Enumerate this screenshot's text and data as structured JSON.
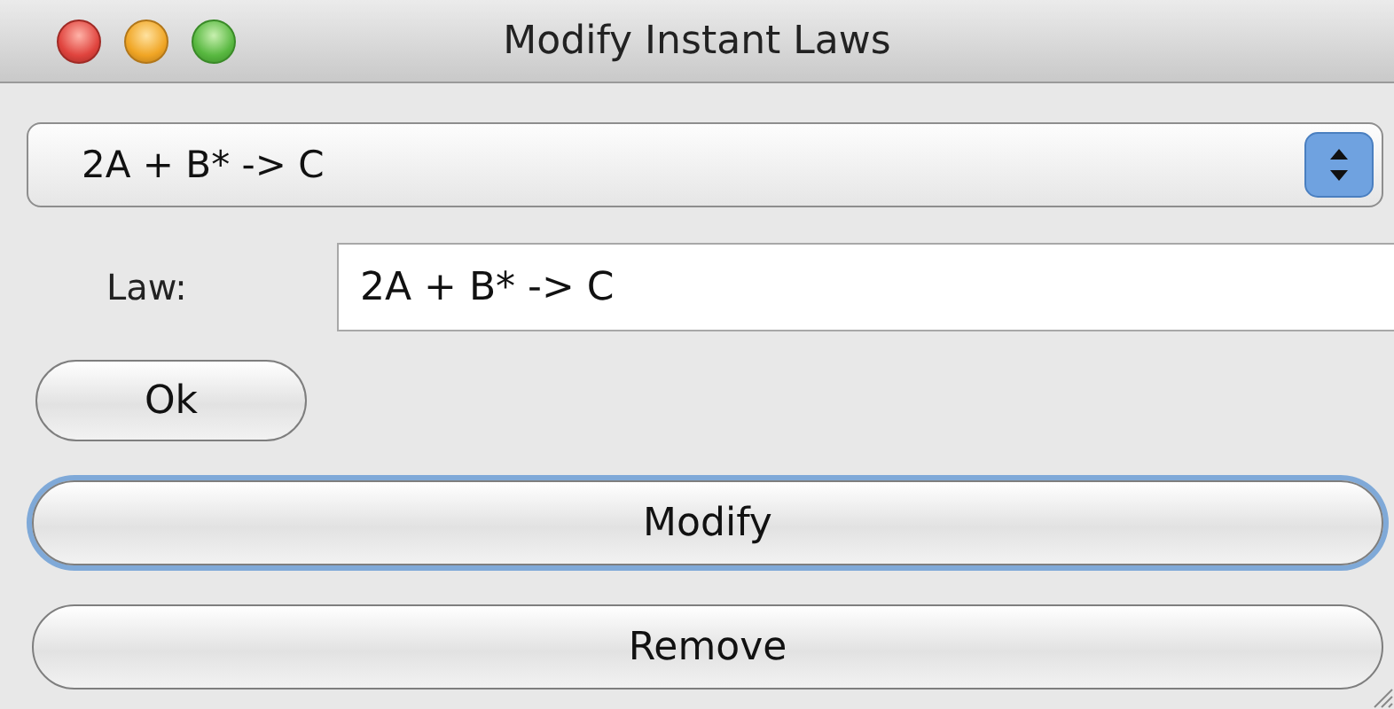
{
  "window": {
    "title": "Modify Instant Laws"
  },
  "law_selector": {
    "value": "2A + B* -> C"
  },
  "law_field": {
    "label": "Law:",
    "value": "2A + B* -> C"
  },
  "buttons": [
    {
      "label": "Ok",
      "kind": "small",
      "focused": false
    },
    {
      "label": "Modify",
      "kind": "wide",
      "focused": true
    },
    {
      "label": "Remove",
      "kind": "wide",
      "focused": false
    }
  ]
}
